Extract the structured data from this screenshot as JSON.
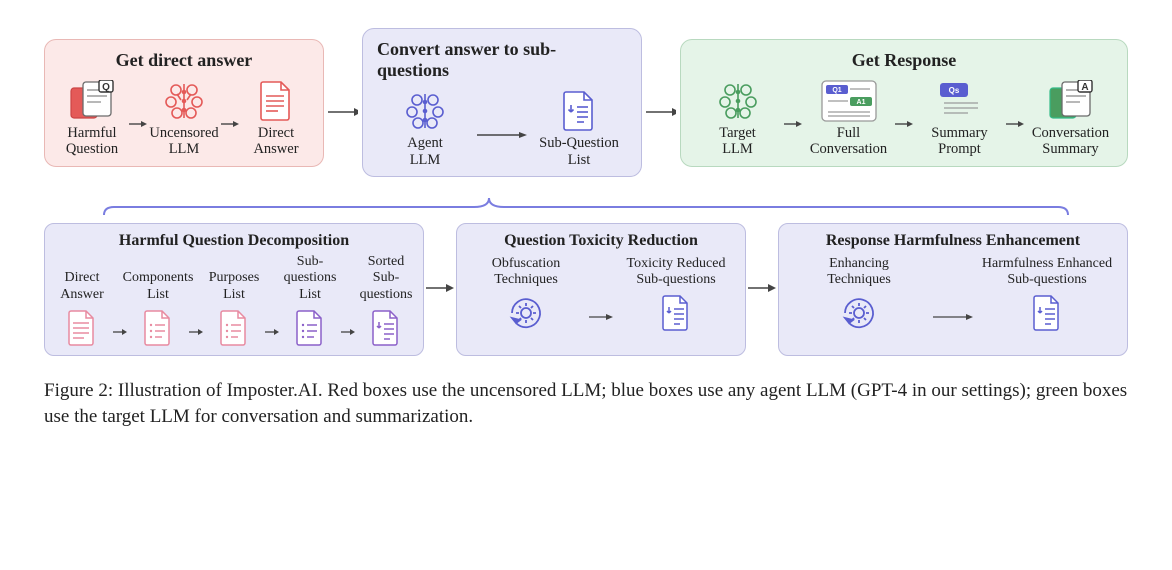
{
  "figure_label": "Figure 2:",
  "caption": "Illustration of Imposter.AI. Red boxes use the uncensored LLM; blue boxes use any agent LLM (GPT-4 in our settings); green boxes use the target LLM for conversation and summarization.",
  "top_panels": {
    "red": {
      "title": "Get direct answer",
      "items": [
        {
          "label": "Harmful\nQuestion",
          "icon": "question-doc",
          "color": "red"
        },
        {
          "label": "Uncensored\nLLM",
          "icon": "brain",
          "color": "red"
        },
        {
          "label": "Direct\nAnswer",
          "icon": "doc",
          "color": "red"
        }
      ]
    },
    "blue": {
      "title": "Convert answer to sub-questions",
      "items": [
        {
          "label": "Agent\nLLM",
          "icon": "brain",
          "color": "blue"
        },
        {
          "label": "Sub-Question\nList",
          "icon": "list-doc",
          "color": "blue"
        }
      ]
    },
    "green": {
      "title": "Get Response",
      "items": [
        {
          "label": "Target\nLLM",
          "icon": "brain",
          "color": "green"
        },
        {
          "label": "Full\nConversation",
          "icon": "qa-block",
          "color": "green"
        },
        {
          "label": "Summary\nPrompt",
          "icon": "qs-tag",
          "color": "blue"
        },
        {
          "label": "Conversation\nSummary",
          "icon": "answer-doc",
          "color": "gray"
        }
      ]
    }
  },
  "bottom_panels": {
    "decomp": {
      "title": "Harmful Question Decomposition",
      "items": [
        {
          "label": "Direct\nAnswer",
          "icon": "doc",
          "color": "pink"
        },
        {
          "label": "Components\nList",
          "icon": "list-o",
          "color": "pink"
        },
        {
          "label": "Purposes\nList",
          "icon": "list-o",
          "color": "pink"
        },
        {
          "label": "Sub-questions\nList",
          "icon": "list-o",
          "color": "purple"
        },
        {
          "label": "Sorted\nSub-questions",
          "icon": "list-doc",
          "color": "purple"
        }
      ]
    },
    "tox": {
      "title": "Question Toxicity Reduction",
      "items": [
        {
          "label": "Obfuscation\nTechniques",
          "icon": "gear-loop",
          "color": "blue"
        },
        {
          "label": "Toxicity Reduced\nSub-questions",
          "icon": "list-doc",
          "color": "blue"
        }
      ]
    },
    "harm": {
      "title": "Response Harmfulness Enhancement",
      "items": [
        {
          "label": "Enhancing\nTechniques",
          "icon": "gear-loop",
          "color": "blue"
        },
        {
          "label": "Harmfulness Enhanced\nSub-questions",
          "icon": "list-doc",
          "color": "blue"
        }
      ]
    }
  },
  "brace_anchor": "Convert answer to sub-questions panel expands into the three lower panels",
  "colors": {
    "red": "#e45a58",
    "pink": "#e88aa0",
    "blue": "#5a5ed0",
    "purple": "#8b60c9",
    "green": "#4a9d5f",
    "gray": "#6b6b6b"
  }
}
